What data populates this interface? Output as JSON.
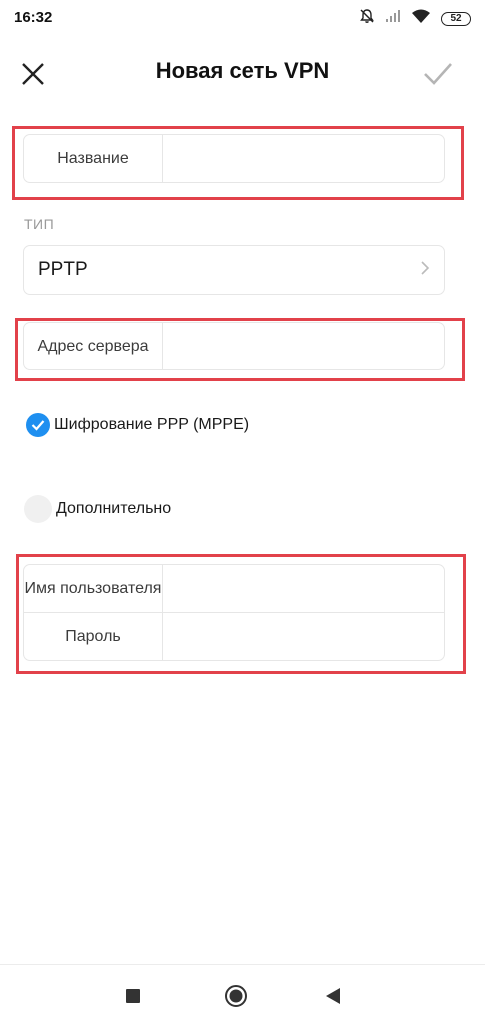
{
  "status_bar": {
    "time": "16:32",
    "battery": "52",
    "icons": [
      "bell-off-icon",
      "signal-icon",
      "wifi-icon",
      "battery-icon"
    ]
  },
  "header": {
    "title": "Новая сеть VPN",
    "close_icon": "close-icon",
    "confirm_icon": "check-icon"
  },
  "form": {
    "name": {
      "label": "Название",
      "value": ""
    },
    "type_section_label": "ТИП",
    "type": {
      "value": "PPTP",
      "icon": "chevron-right-icon"
    },
    "server": {
      "label": "Адрес сервера",
      "value": ""
    },
    "encryption": {
      "label": "Шифрование PPP (MPPE)",
      "checked": true
    },
    "advanced": {
      "label": "Дополнительно",
      "checked": false
    },
    "username": {
      "label": "Имя пользователя",
      "value": ""
    },
    "password": {
      "label": "Пароль",
      "value": ""
    }
  },
  "highlight_color": "#e2414a",
  "accent_color": "#1e8ff0",
  "nav_bar": {
    "items": [
      "recent-apps-icon",
      "home-icon",
      "back-icon"
    ]
  }
}
